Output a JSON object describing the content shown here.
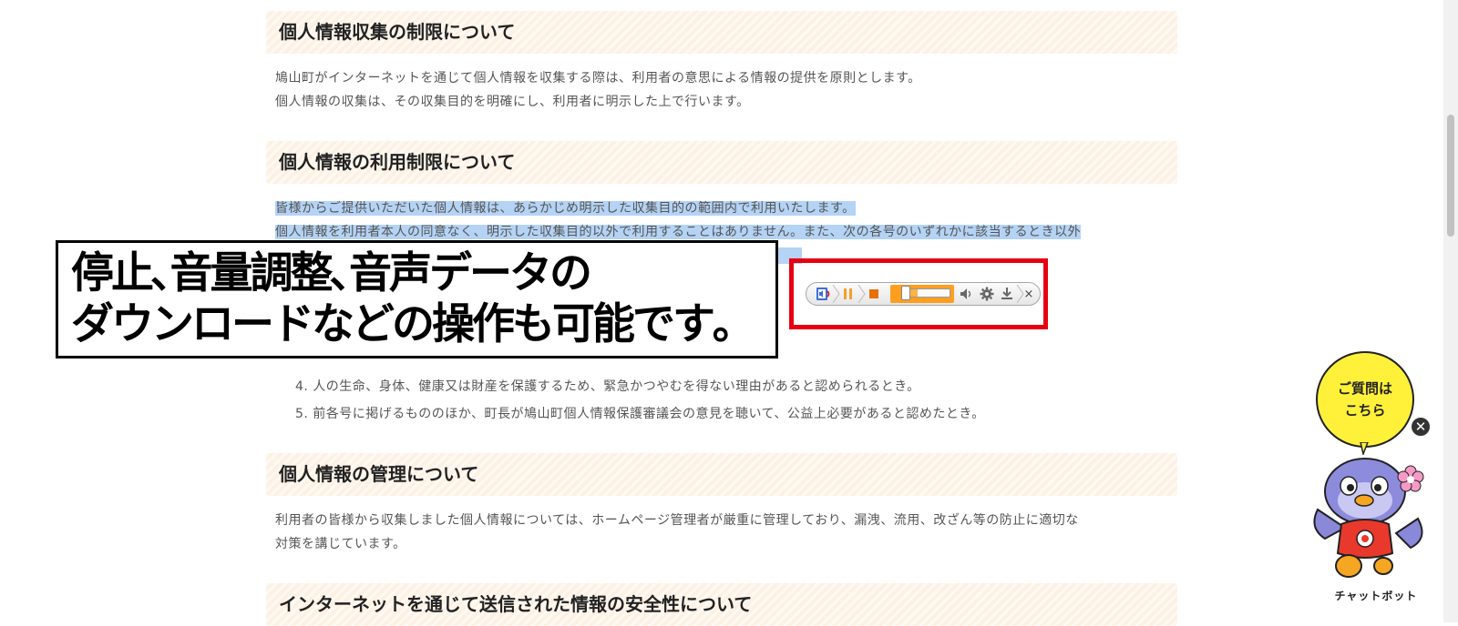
{
  "sections": [
    {
      "heading": "個人情報収集の制限について",
      "paragraphs": [
        "鳩山町がインターネットを通じて個人情報を収集する際は、利用者の意思による情報の提供を原則とします。",
        "個人情報の収集は、その収集目的を明確にし、利用者に明示した上で行います。"
      ]
    },
    {
      "heading": "個人情報の利用制限について",
      "paragraphs": [
        "皆様からご提供いただいた個人情報は、あらかじめ明示した収集目的の範囲内で利用いたします。",
        "個人情報を利用者本人の同意なく、明示した収集目的以外で利用することはありません。また、次の各号のいずれかに該当するとき以外"
      ],
      "list_items": [
        "4. 人の生命、身体、健康又は財産を保護するため、緊急かつやむを得ない理由があると認められるとき。",
        "5. 前各号に掲げるもののほか、町長が鳩山町個人情報保護審議会の意見を聴いて、公益上必要があると認めたとき。"
      ]
    },
    {
      "heading": "個人情報の管理について",
      "paragraphs": [
        "利用者の皆様から収集しました個人情報については、ホームページ管理者が厳重に管理しており、漏洩、流用、改ざん等の防止に適切な",
        "対策を講じています。"
      ]
    },
    {
      "heading": "インターネットを通じて送信された情報の安全性について"
    }
  ],
  "caption": {
    "line1": "停止､音量調整､音声データの",
    "line2": "ダウンロードなどの操作も可能です｡"
  },
  "player": {
    "icons": [
      "speaker-icon",
      "pause-icon",
      "stop-icon",
      "volume-slider",
      "mute-icon",
      "gear-icon",
      "download-icon",
      "close-icon"
    ],
    "volume_level": 0.2,
    "close_label": "×"
  },
  "chatbot": {
    "bubble_text": "ご質問は\nこちら",
    "label": "チャットボット",
    "close_label": "✕"
  },
  "colors": {
    "heading_bg": "#fdf1e4",
    "selection": "#b4d3f5",
    "frame": "#e60012",
    "player_accent": "#ff9f1f",
    "bubble": "#fff13a"
  }
}
